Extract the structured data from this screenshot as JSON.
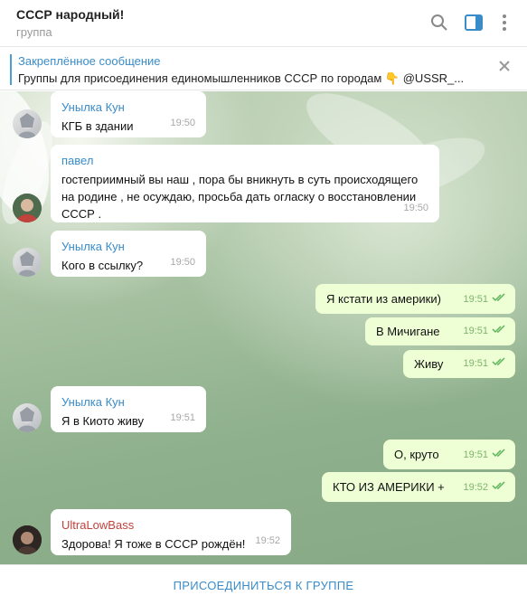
{
  "header": {
    "title": "СССР народный!",
    "subtitle": "группа"
  },
  "pinned": {
    "title": "Закреплённое сообщение",
    "text": "Группы для присоединения единомышленников СССР по городам 👇 @USSR_..."
  },
  "messages": [
    {
      "sender": "Унылка Кун",
      "text": "КГБ в здании",
      "time": "19:50"
    },
    {
      "sender": "павел",
      "text": "гостеприимный вы наш , пора бы вникнуть в суть происходящего на родине , не осуждаю, просьба дать огласку о восстановлении СССР .",
      "time": "19:50"
    },
    {
      "sender": "Унылка Кун",
      "text": "Кого в ссылку?",
      "time": "19:50"
    },
    {
      "text": "Я кстати из америки)",
      "time": "19:51"
    },
    {
      "text": "В Мичигане",
      "time": "19:51"
    },
    {
      "text": "Живу",
      "time": "19:51"
    },
    {
      "sender": "Унылка Кун",
      "text": "Я в Киото живу",
      "time": "19:51"
    },
    {
      "text": "О, круто",
      "time": "19:51"
    },
    {
      "text": "КТО ИЗ АМЕРИКИ +",
      "time": "19:52"
    },
    {
      "sender": "UltraLowBass",
      "text": "Здорова! Я тоже в СССР рождён!",
      "time": "19:52"
    }
  ],
  "footer": {
    "join_label": "ПРИСОЕДИНИТЬСЯ К ГРУППЕ"
  },
  "colors": {
    "accent": "#3a8cc9",
    "outgoing_bubble": "#eefed5",
    "check": "#5cb55a",
    "sender_red": "#c0433c"
  }
}
